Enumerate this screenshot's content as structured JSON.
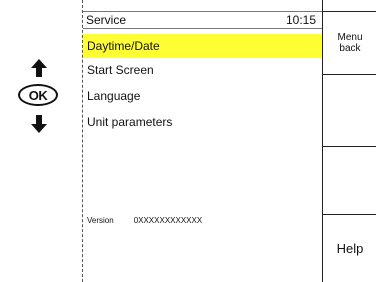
{
  "nav": {
    "ok_label": "OK"
  },
  "screen": {
    "title": "Service",
    "time": "10:15",
    "menu_items": [
      {
        "label": "Daytime/Date",
        "selected": true
      },
      {
        "label": "Start  Screen",
        "selected": false
      },
      {
        "label": "Language",
        "selected": false
      },
      {
        "label": "Unit  parameters",
        "selected": false
      }
    ],
    "version_label": "Version",
    "version_value": "0XXXXXXXXXXXX"
  },
  "softkeys": {
    "menu_back": "Menu\nback",
    "key2": "",
    "key3": "",
    "help": "Help"
  },
  "colors": {
    "selection": "#ffff33"
  }
}
